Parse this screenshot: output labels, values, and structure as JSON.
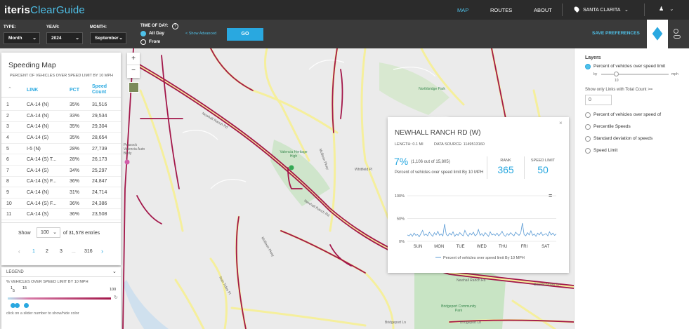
{
  "header": {
    "logo_primary": "iteris",
    "logo_secondary": "ClearGuide",
    "nav": {
      "map": "MAP",
      "routes": "ROUTES",
      "about": "ABOUT"
    },
    "location": "SANTA CLARITA",
    "location_icon": "map-pin-icon",
    "user_icon": "user-icon"
  },
  "controls": {
    "type_label": "TYPE:",
    "type_value": "Month",
    "year_label": "YEAR:",
    "year_value": "2024",
    "month_label": "MONTH:",
    "month_value": "September",
    "tod_label": "TIME OF DAY:",
    "allday_label": "All Day",
    "from_label": "From",
    "show_advanced": "< Show Advanced",
    "go_label": "GO",
    "save_prefs": "SAVE PREFERENCES"
  },
  "speeding": {
    "title": "Speeding Map",
    "subtitle": "PERCENT OF VEHICLES OVER SPEED LIMIT BY 10 MPH",
    "columns": {
      "link": "LINK",
      "pct": "PCT",
      "count_l1": "Speed",
      "count_l2": "Count"
    },
    "rows": [
      {
        "n": "1",
        "link": "CA-14 (N)",
        "pct": "35%",
        "count": "31,516"
      },
      {
        "n": "2",
        "link": "CA-14 (N)",
        "pct": "33%",
        "count": "29,534"
      },
      {
        "n": "3",
        "link": "CA-14 (N)",
        "pct": "35%",
        "count": "29,304"
      },
      {
        "n": "4",
        "link": "CA-14 (S)",
        "pct": "35%",
        "count": "28,654"
      },
      {
        "n": "5",
        "link": "I-5 (N)",
        "pct": "28%",
        "count": "27,739"
      },
      {
        "n": "6",
        "link": "CA-14 (S) T...",
        "pct": "28%",
        "count": "26,173"
      },
      {
        "n": "7",
        "link": "CA-14 (S)",
        "pct": "34%",
        "count": "25,297"
      },
      {
        "n": "8",
        "link": "CA-14 (S) F...",
        "pct": "36%",
        "count": "24,847"
      },
      {
        "n": "9",
        "link": "CA-14 (N)",
        "pct": "31%",
        "count": "24,714"
      },
      {
        "n": "10",
        "link": "CA-14 (S) F...",
        "pct": "36%",
        "count": "24,386"
      },
      {
        "n": "11",
        "link": "CA-14 (S)",
        "pct": "36%",
        "count": "23,508"
      }
    ],
    "show_label": "Show",
    "show_value": "100",
    "entries_text": "of 31,578 entries",
    "pages": [
      "1",
      "2",
      "3",
      "...",
      "316"
    ]
  },
  "legend": {
    "title": "LEGEND",
    "subtitle": "% VEHICLES OVER SPEED LIMIT BY 10 MPH",
    "tick_1": "1",
    "tick_5": "5",
    "tick_15": "15",
    "tick_100": "100",
    "hint": "click on a slider number to show/hide color"
  },
  "popup": {
    "title": "NEWHALL RANCH RD (W)",
    "length": "LENGTH: 0.1 MI",
    "source": "DATA SOURCE: 1149513160",
    "pct": "7%",
    "pct_detail": "(1,106 out of 15,805)",
    "pct_desc": "Percent of vehicles over speed limit By 10 MPH",
    "rank_label": "RANK",
    "rank_value": "365",
    "limit_label": "SPEED LIMIT",
    "limit_value": "50",
    "legend_label": "Percent of vehicles over speed limit By 10 MPH"
  },
  "chart_data": {
    "type": "line",
    "x": [
      "SUN",
      "MON",
      "TUE",
      "WED",
      "THU",
      "FRI",
      "SAT"
    ],
    "y_ticks": [
      "100%",
      "50%",
      "0%"
    ],
    "ylim": [
      0,
      100
    ],
    "series": [
      {
        "name": "Percent of vehicles over speed limit By 10 MPH",
        "values": [
          14,
          12,
          16,
          11,
          18,
          13,
          15,
          10,
          17,
          24,
          13,
          16,
          12,
          20,
          15,
          11,
          19,
          14,
          22,
          13,
          16,
          12,
          38,
          15,
          12,
          18,
          14,
          21,
          11,
          16,
          13,
          19,
          15,
          12,
          24,
          16,
          11,
          18,
          14,
          20,
          12,
          15,
          26,
          13,
          17,
          12,
          19,
          15,
          11,
          21,
          14,
          16,
          13,
          18,
          12,
          16,
          22,
          14,
          11,
          17,
          13,
          19,
          15,
          12,
          20,
          16,
          13,
          18,
          40,
          15,
          12,
          19,
          14,
          23,
          13,
          16,
          11,
          18,
          14,
          20,
          13,
          15,
          17,
          12,
          21,
          14,
          18,
          13,
          16
        ]
      }
    ],
    "color": "#5b9bd5"
  },
  "layers": {
    "title": "Layers",
    "opt1": "Percent of vehicles over speed limit",
    "by_label": "by",
    "mph_label": "mph",
    "slider_value": "10",
    "min_count_label": "Show only Links with Total Count >=",
    "min_count_value": "0",
    "opt2": "Percent of vehicles over speed of",
    "opt3": "Percentile Speeds",
    "opt4": "Standard deviation of speeds",
    "opt5": "Speed Limit"
  },
  "map_labels": {
    "newhall_ranch_rd": "Newhall Ranch Rd",
    "mcbean_pkwy": "McBean Pkwy",
    "whitfield_pl": "Whitfield Pl",
    "valencia_school": "Valencia Heritage High",
    "bridgeport_park": "Bridgeport Community Park",
    "northbridge_park": "Northbridge Park",
    "bridgeport_ln": "Bridgeport Ln",
    "twin_tides": "Twin Tides Pl",
    "beachcomber": "Beachcomber Ln",
    "peacock": "Peacock Valencia Auto Body"
  },
  "colors": {
    "accent": "#29a8e0",
    "header": "#2b2b2b",
    "controls": "#3a3a3a",
    "speeding_road": "#a3174a",
    "road": "#f5ef9c"
  }
}
